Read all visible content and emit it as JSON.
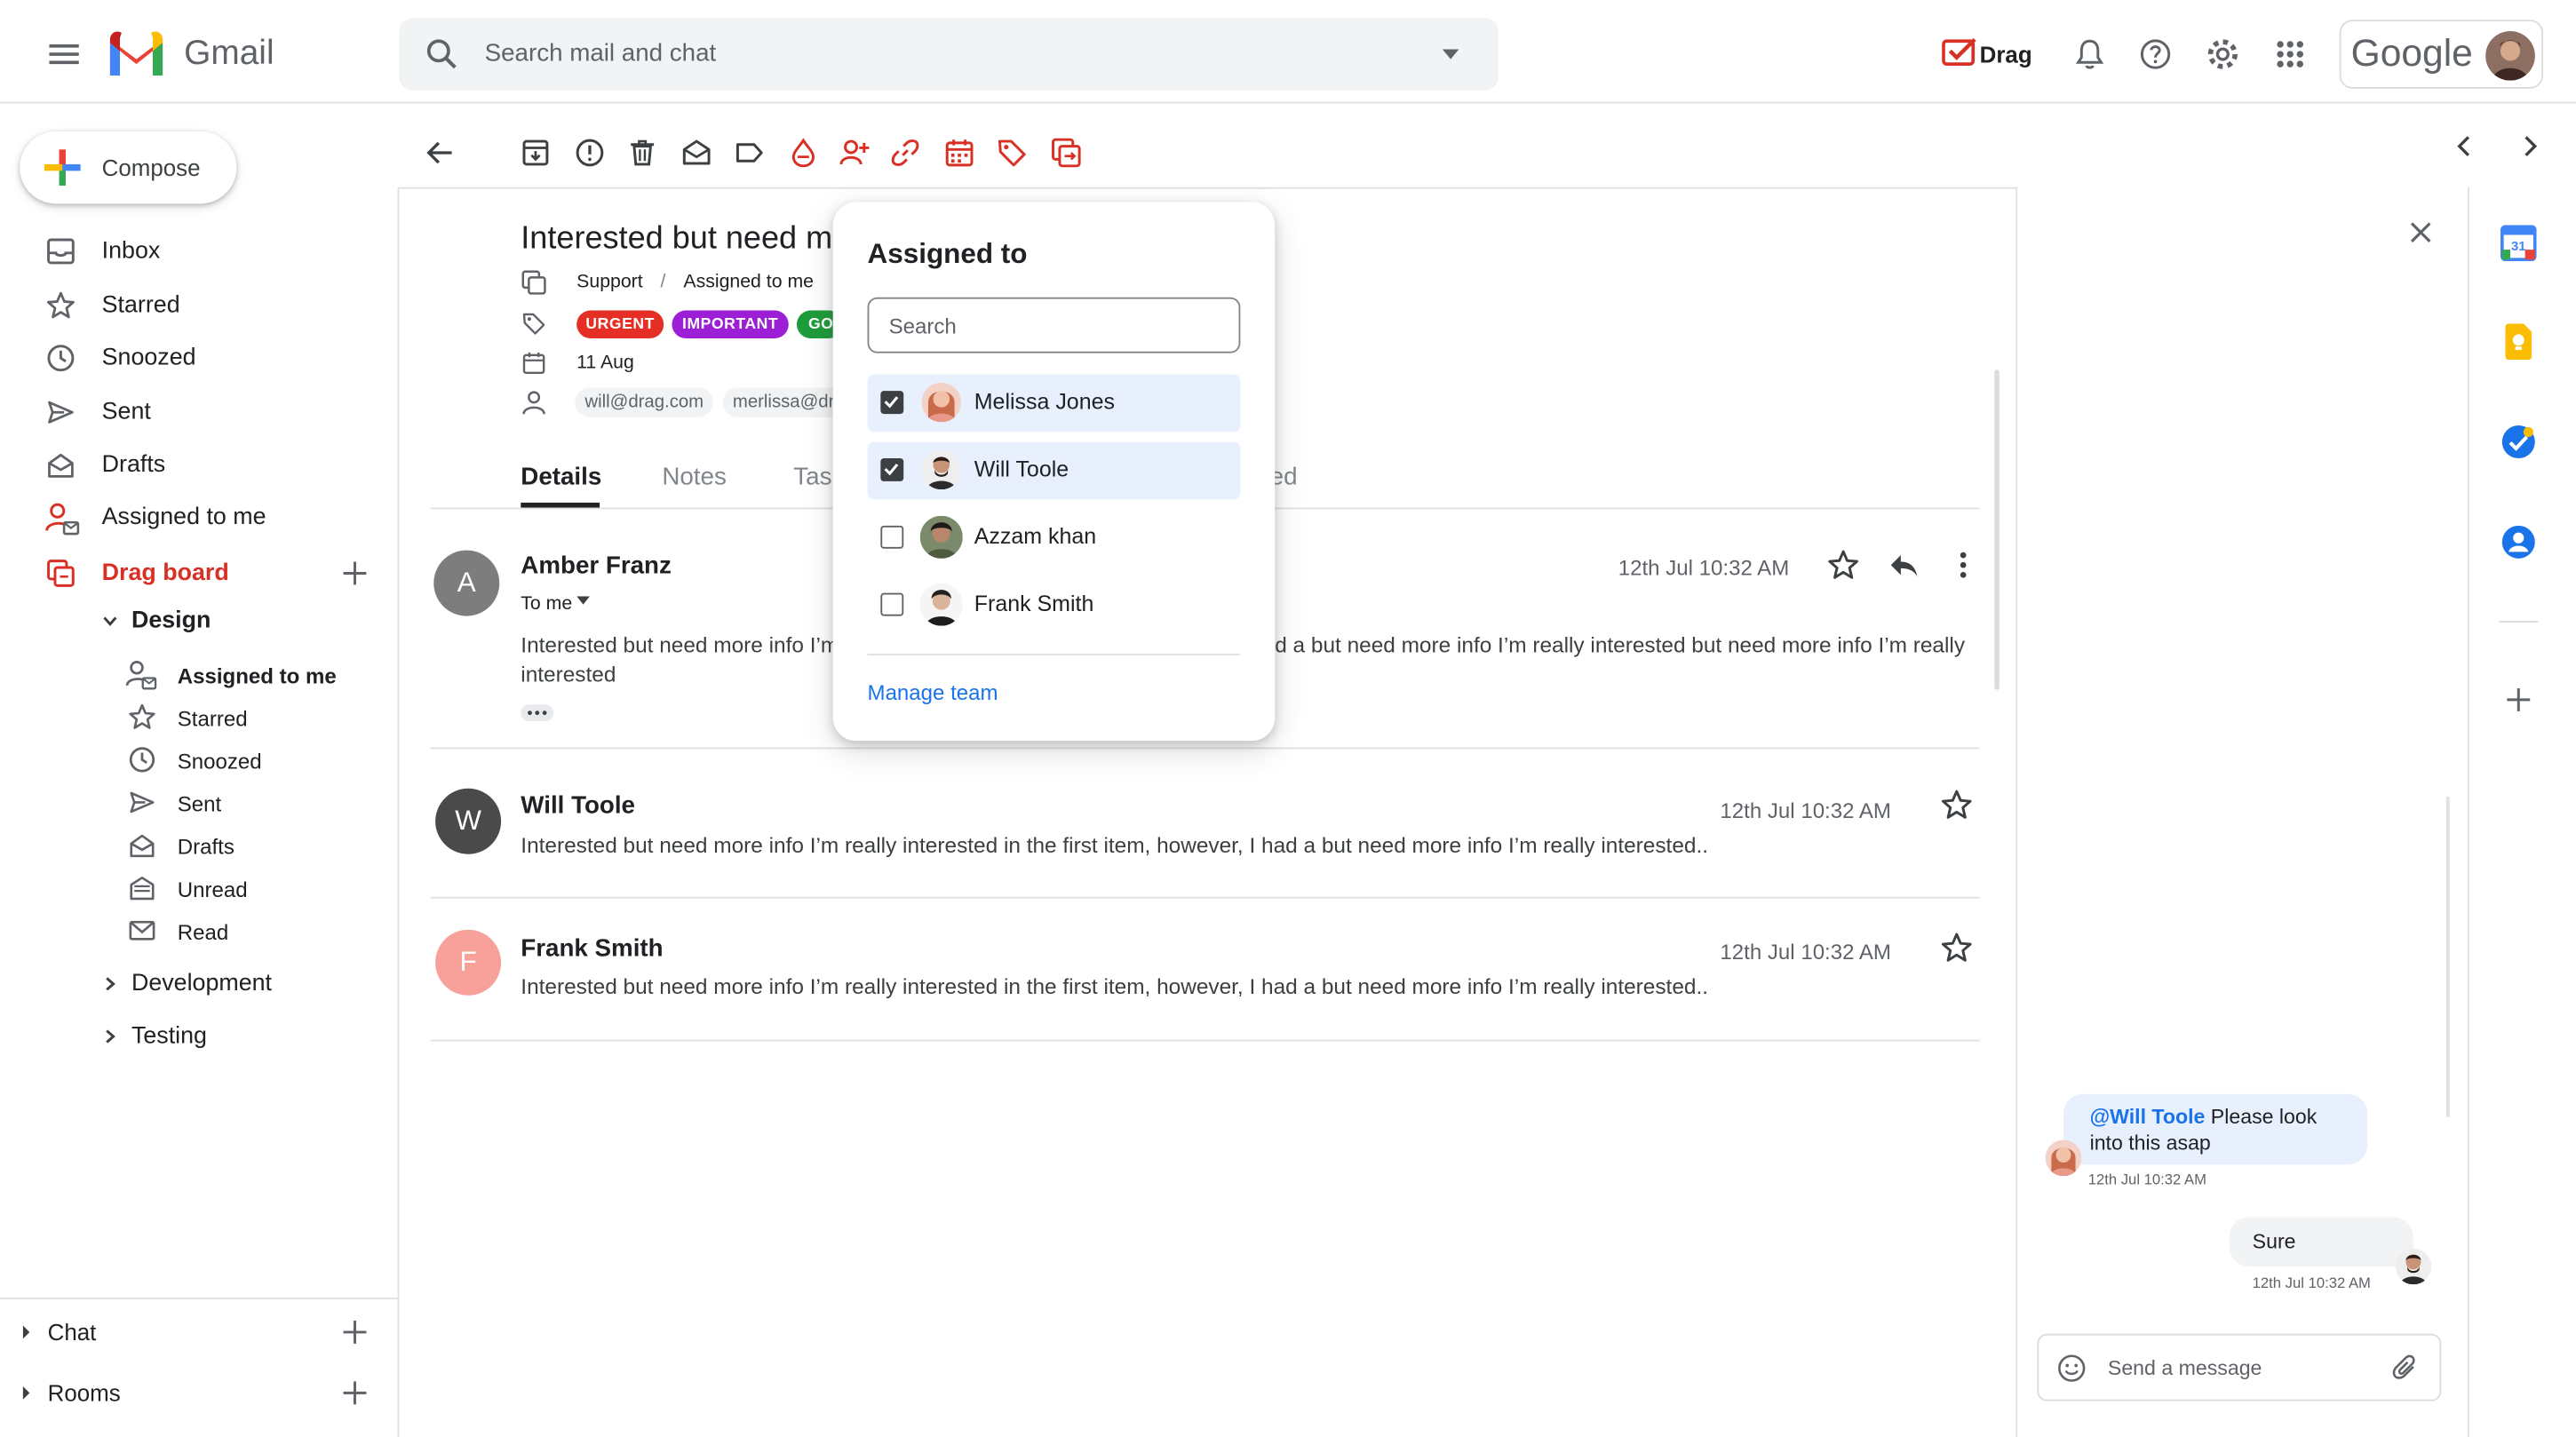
{
  "app": {
    "brand": "Gmail",
    "search_placeholder": "Search mail and chat",
    "drag_label": "Drag",
    "google_label": "Google"
  },
  "sidebar": {
    "compose": "Compose",
    "items": [
      {
        "label": "Inbox"
      },
      {
        "label": "Starred"
      },
      {
        "label": "Snoozed"
      },
      {
        "label": "Sent"
      },
      {
        "label": "Drafts"
      },
      {
        "label": "Assigned to me"
      }
    ],
    "drag_board": "Drag board",
    "design": "Design",
    "design_items": [
      {
        "label": "Assigned to me"
      },
      {
        "label": "Starred"
      },
      {
        "label": "Snoozed"
      },
      {
        "label": "Sent"
      },
      {
        "label": "Drafts"
      },
      {
        "label": "Unread"
      },
      {
        "label": "Read"
      }
    ],
    "development": "Development",
    "testing": "Testing",
    "chat": "Chat",
    "rooms": "Rooms"
  },
  "email": {
    "subject": "Interested but need m",
    "breadcrumb_support": "Support",
    "breadcrumb_sep": "/",
    "breadcrumb_assigned": "Assigned to me",
    "tags": [
      {
        "label": "URGENT",
        "color": "#e52f25"
      },
      {
        "label": "IMPORTANT",
        "color": "#9c1fd6"
      },
      {
        "label": "GO",
        "color": "#1e9c3a"
      }
    ],
    "date": "11 Aug",
    "participants": [
      "will@drag.com",
      "merlissa@dr"
    ],
    "tabs": [
      "Details",
      "Notes",
      "Tas",
      "ed"
    ]
  },
  "messages": [
    {
      "initial": "A",
      "avatar_color": "#7d7d7d",
      "sender": "Amber Franz",
      "to": "To me",
      "time": "12th Jul 10:32 AM",
      "snippet_left": "Interested but need more info I’m",
      "snippet_right": "d a but need more info I’m really interested but need more info I’m really",
      "snippet_line2": "interested"
    },
    {
      "initial": "W",
      "avatar_color": "#4a4a4a",
      "sender": "Will Toole",
      "time": "12th Jul 10:32 AM",
      "snippet": "Interested but need more info I’m really interested in the first item, however, I had a but need more info I’m really interested.."
    },
    {
      "initial": "F",
      "avatar_color": "#f8a19a",
      "sender": "Frank Smith",
      "time": "12th Jul 10:32 AM",
      "snippet": "Interested but need more info I’m really interested in the first item, however, I had a but need more info I’m really interested.."
    }
  ],
  "assign_popup": {
    "title": "Assigned to",
    "search_placeholder": "Search",
    "people": [
      {
        "name": "Melissa Jones",
        "checked": true
      },
      {
        "name": "Will Toole",
        "checked": true
      },
      {
        "name": "Azzam khan",
        "checked": false
      },
      {
        "name": "Frank Smith",
        "checked": false
      }
    ],
    "manage": "Manage team"
  },
  "chat_panel": {
    "mention": "@Will Toole",
    "msg1_rest": " Please look",
    "msg1_line2": "into this asap",
    "msg1_time": "12th Jul 10:32 AM",
    "msg2": "Sure",
    "msg2_time": "12th Jul 10:32 AM",
    "input_placeholder": "Send a message"
  },
  "colors": {
    "accent_red": "#d93025",
    "link_blue": "#1a73e8",
    "selected_row": "#e8f0fe"
  }
}
